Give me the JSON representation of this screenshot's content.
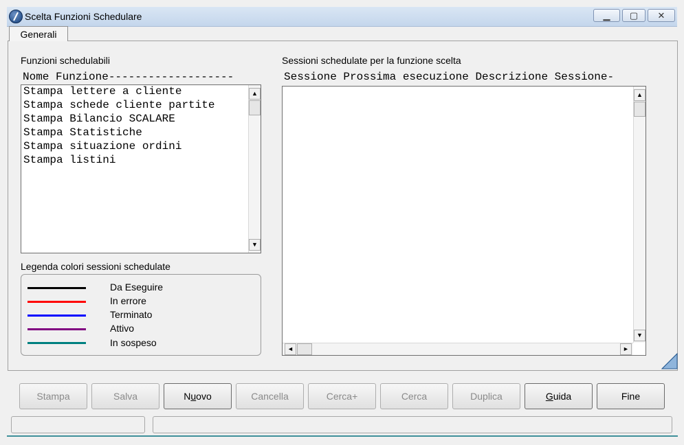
{
  "window": {
    "title": "Scelta Funzioni Schedulare",
    "minimize_glyph": "▁",
    "maximize_glyph": "▢",
    "close_glyph": "✕",
    "icon": "app-logo-icon"
  },
  "tabs": [
    {
      "label": "Generali"
    }
  ],
  "functions": {
    "label": "Funzioni schedulabili",
    "header": "Nome Funzione-------------------",
    "items": [
      "Stampa lettere a cliente",
      "Stampa schede cliente partite",
      "Stampa Bilancio SCALARE",
      "Stampa Statistiche",
      "Stampa situazione ordini",
      "Stampa listini"
    ]
  },
  "sessions": {
    "label": "Sessioni schedulate per la funzione scelta",
    "header": "Sessione Prossima esecuzione Descrizione Sessione-",
    "items": []
  },
  "legend": {
    "label": "Legenda colori sessioni schedulate",
    "items": [
      {
        "label": "Da Eseguire",
        "color": "#000000"
      },
      {
        "label": "In errore",
        "color": "#ff0000"
      },
      {
        "label": "Terminato",
        "color": "#0000ff"
      },
      {
        "label": "Attivo",
        "color": "#800080"
      },
      {
        "label": "In sospeso",
        "color": "#008080"
      }
    ]
  },
  "scroll_glyphs": {
    "up": "▲",
    "down": "▼",
    "left": "◄",
    "right": "►"
  },
  "buttons": {
    "stampa": "Stampa",
    "salva": "Salva",
    "nuovo_pre": "N",
    "nuovo_u": "u",
    "nuovo_post": "ovo",
    "cancella": "Cancella",
    "cerca_plus": "Cerca+",
    "cerca": "Cerca",
    "duplica": "Duplica",
    "guida_u": "G",
    "guida_post": "uida",
    "fine": "Fine"
  },
  "status": {
    "left": "",
    "right": ""
  }
}
